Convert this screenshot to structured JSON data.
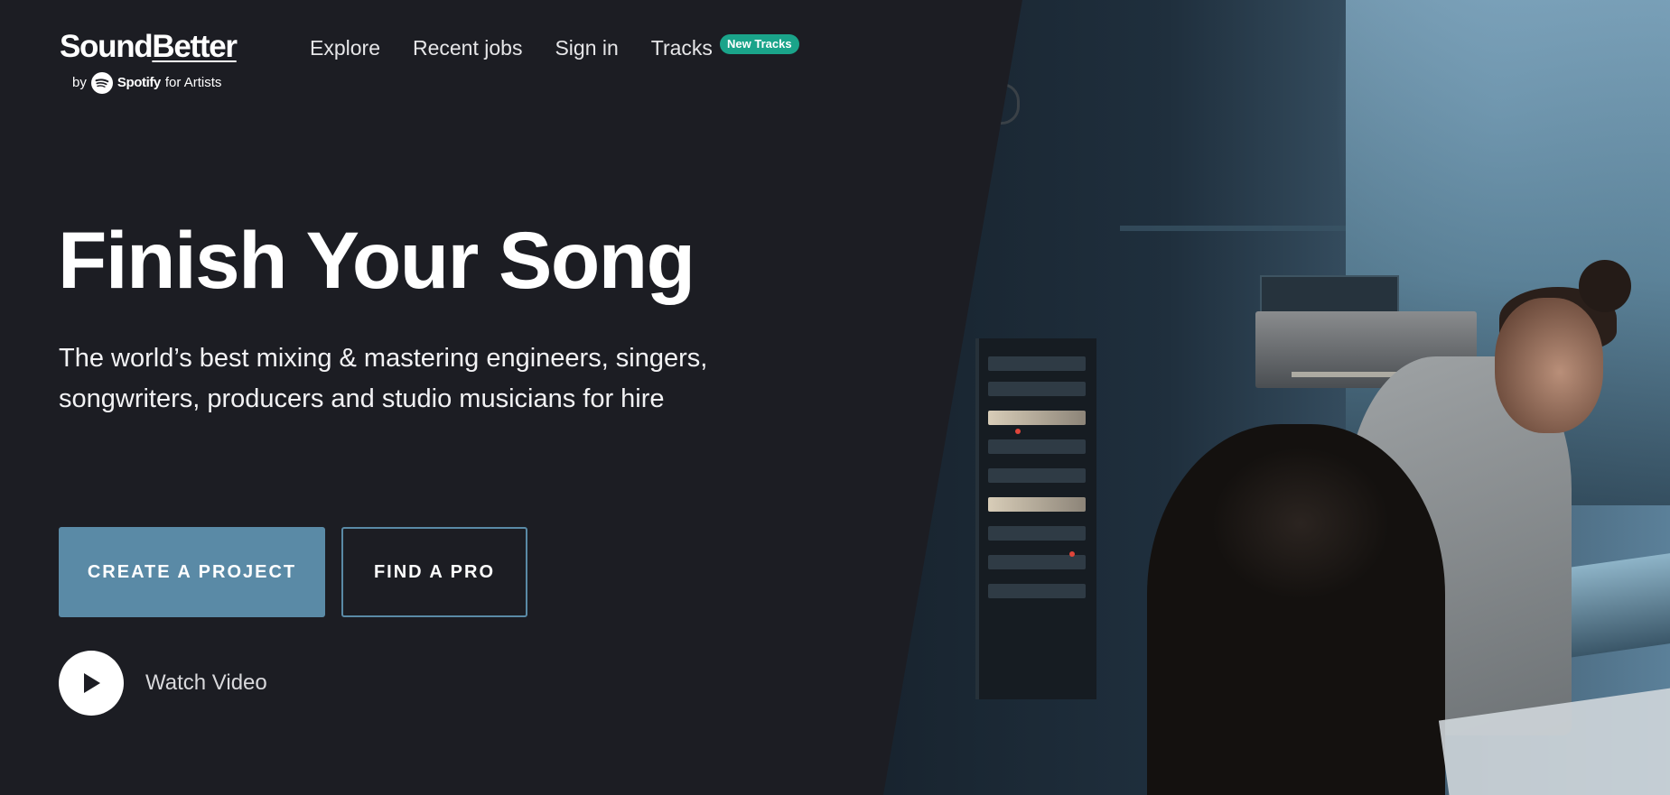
{
  "header": {
    "logo": {
      "wordmark": "SoundBetter",
      "prefix": "by",
      "brand": "Spotify",
      "suffix": "for Artists"
    },
    "nav": [
      {
        "label": "Explore"
      },
      {
        "label": "Recent jobs"
      },
      {
        "label": "Sign in"
      },
      {
        "label": "Tracks",
        "badge": "New Tracks"
      }
    ]
  },
  "hero": {
    "title": "Finish Your Song",
    "subtitle": "The world’s best mixing & mastering engineers, singers, songwriters, producers and studio musicians for hire",
    "primary_cta": "CREATE A PROJECT",
    "secondary_cta": "FIND A PRO",
    "video_label": "Watch Video"
  },
  "icons": {
    "play": "play-icon",
    "spotify": "spotify-icon"
  },
  "colors": {
    "background": "#1c1d23",
    "accent": "#5a8aa6",
    "badge": "#1aa48a"
  }
}
